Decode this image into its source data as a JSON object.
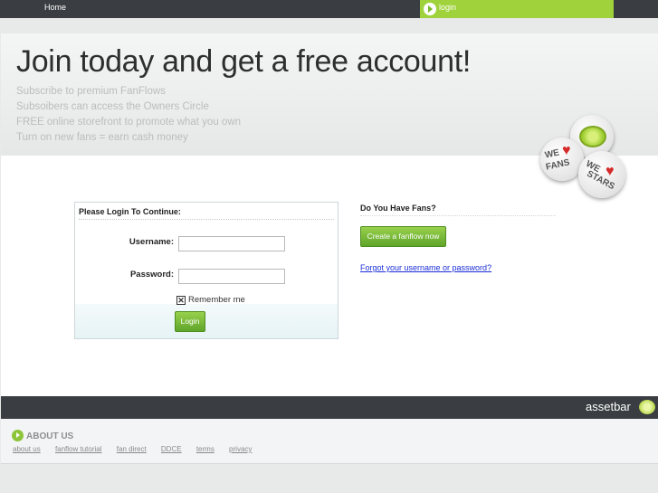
{
  "nav": {
    "home": "Home",
    "login": "login"
  },
  "hero": {
    "title": "Join today and get a free account!",
    "bullets": [
      "Subscribe to premium FanFlows",
      "Subsoibers can access the Owners Circle",
      "FREE online storefront to promote what you own",
      "Turn on new fans = earn cash money"
    ]
  },
  "badges": {
    "fans_top": "WE",
    "fans_bottom": "FANS",
    "stars_top": "WE",
    "stars_bottom": "STARS"
  },
  "login_form": {
    "heading": "Please Login To Continue:",
    "username_label": "Username:",
    "password_label": "Password:",
    "username_value": "",
    "password_value": "",
    "remember_label": "Remember me",
    "remember_checked": true,
    "submit_label": "Login"
  },
  "fans_panel": {
    "heading": "Do You Have Fans?",
    "create_button": "Create a fanflow now",
    "forgot_link": "Forgot your username or password?"
  },
  "footer": {
    "brand": "assetbar",
    "about_heading": "ABOUT US",
    "links": [
      "about us",
      "fanflow tutorial",
      "fan direct",
      "DDCE",
      "terms",
      "privacy"
    ]
  },
  "colors": {
    "accent": "#9fd23b",
    "dark_bar": "#3a3d42",
    "link": "#1a2ed6"
  }
}
